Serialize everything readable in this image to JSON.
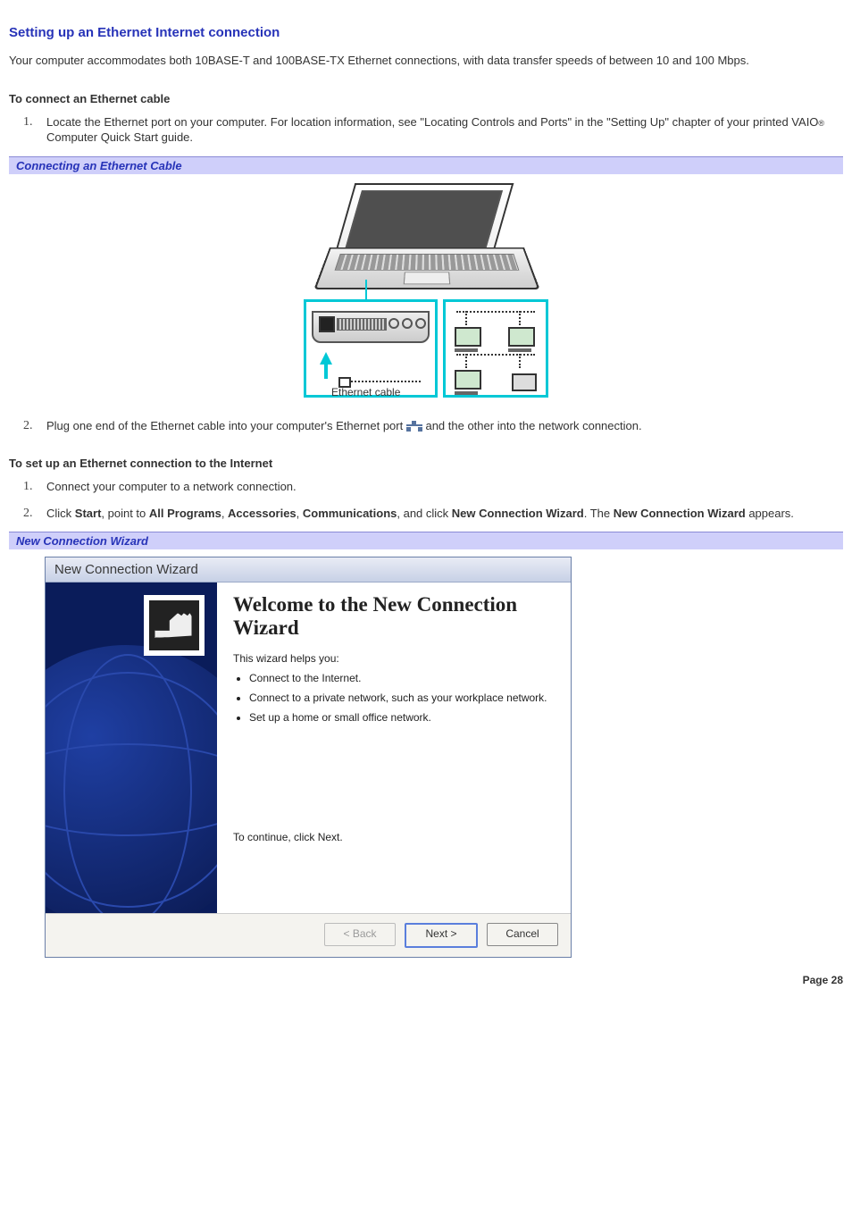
{
  "title": "Setting up an Ethernet Internet connection",
  "intro": "Your computer accommodates both 10BASE-T and 100BASE-TX Ethernet connections, with data transfer speeds of between 10 and 100 Mbps.",
  "section1_heading": "To connect an Ethernet cable",
  "section1_steps": {
    "s1_a": "Locate the Ethernet port on your computer. For location information, see \"Locating Controls and Ports\" in the \"Setting Up\" chapter of your printed VAIO",
    "s1_b": " Computer Quick Start guide.",
    "reg": "®",
    "s2_a": "Plug one end of the Ethernet cable into your computer's Ethernet port ",
    "s2_b": "and the other into the network connection."
  },
  "caption1": "Connecting an Ethernet Cable",
  "figure1_label": "Ethernet cable",
  "section2_heading": "To set up an Ethernet connection to the Internet",
  "section2_steps": {
    "s1": "Connect your computer to a network connection.",
    "s2_parts": {
      "a": "Click ",
      "b": "Start",
      "c": ", point to ",
      "d": "All Programs",
      "e": ", ",
      "f": "Accessories",
      "g": ", ",
      "h": "Communications",
      "i": ", and click ",
      "j": "New Connection Wizard",
      "k": ". The ",
      "l": "New Connection Wizard",
      "m": " appears."
    }
  },
  "caption2": "New Connection Wizard",
  "wizard": {
    "titlebar": "New Connection Wizard",
    "heading": "Welcome to the New Connection Wizard",
    "helps_you": "This wizard helps you:",
    "bullets": [
      "Connect to the Internet.",
      "Connect to a private network, such as your workplace network.",
      "Set up a home or small office network."
    ],
    "continue": "To continue, click Next.",
    "buttons": {
      "back": "< Back",
      "next": "Next >",
      "cancel": "Cancel"
    }
  },
  "page_number": "Page 28"
}
